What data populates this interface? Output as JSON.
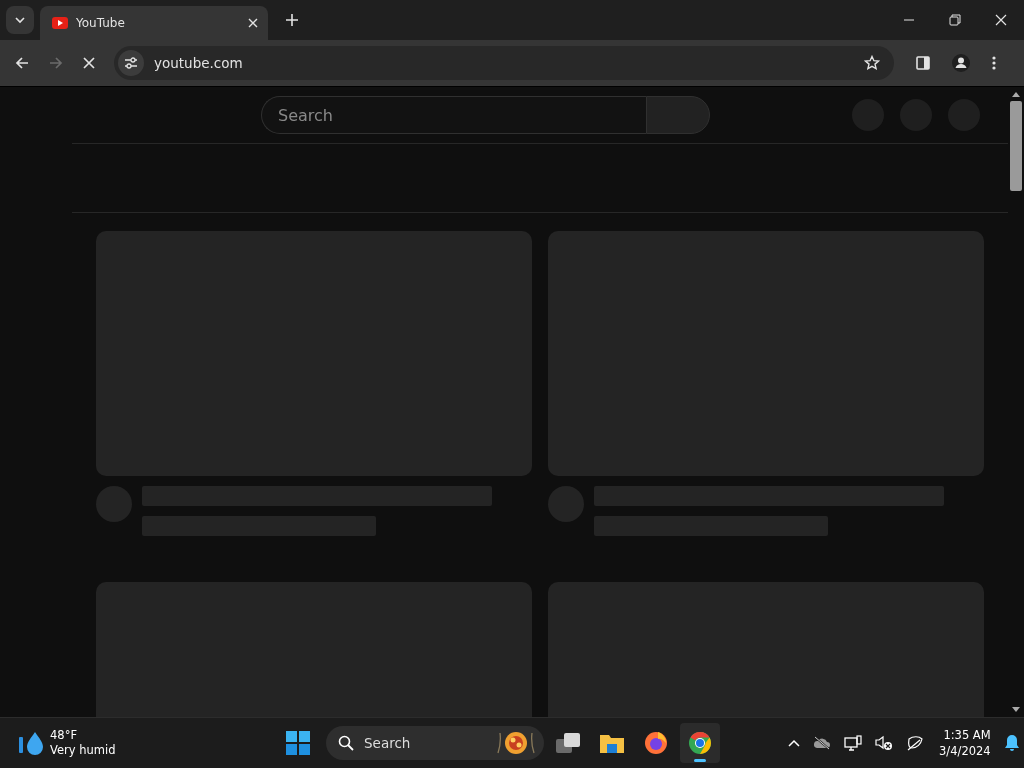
{
  "browser": {
    "tabs": [
      {
        "title": "YouTube",
        "selected": true
      }
    ],
    "url": "youtube.com",
    "loading": true
  },
  "page": {
    "search": {
      "placeholder": "Search"
    },
    "cards": [
      {
        "kind": "skeleton"
      },
      {
        "kind": "skeleton"
      },
      {
        "kind": "thumbnail"
      },
      {
        "kind": "thumbnail"
      }
    ]
  },
  "taskbar": {
    "weather": {
      "temperature": "48°F",
      "condition": "Very humid"
    },
    "search": {
      "placeholder": "Search"
    },
    "apps": [
      {
        "kind": "task-view",
        "selected": false
      },
      {
        "kind": "files",
        "selected": false
      },
      {
        "kind": "firefox",
        "selected": false
      },
      {
        "kind": "chrome",
        "selected": true
      }
    ],
    "clock": {
      "time": "1:35 AM",
      "date": "3/4/2024"
    }
  }
}
